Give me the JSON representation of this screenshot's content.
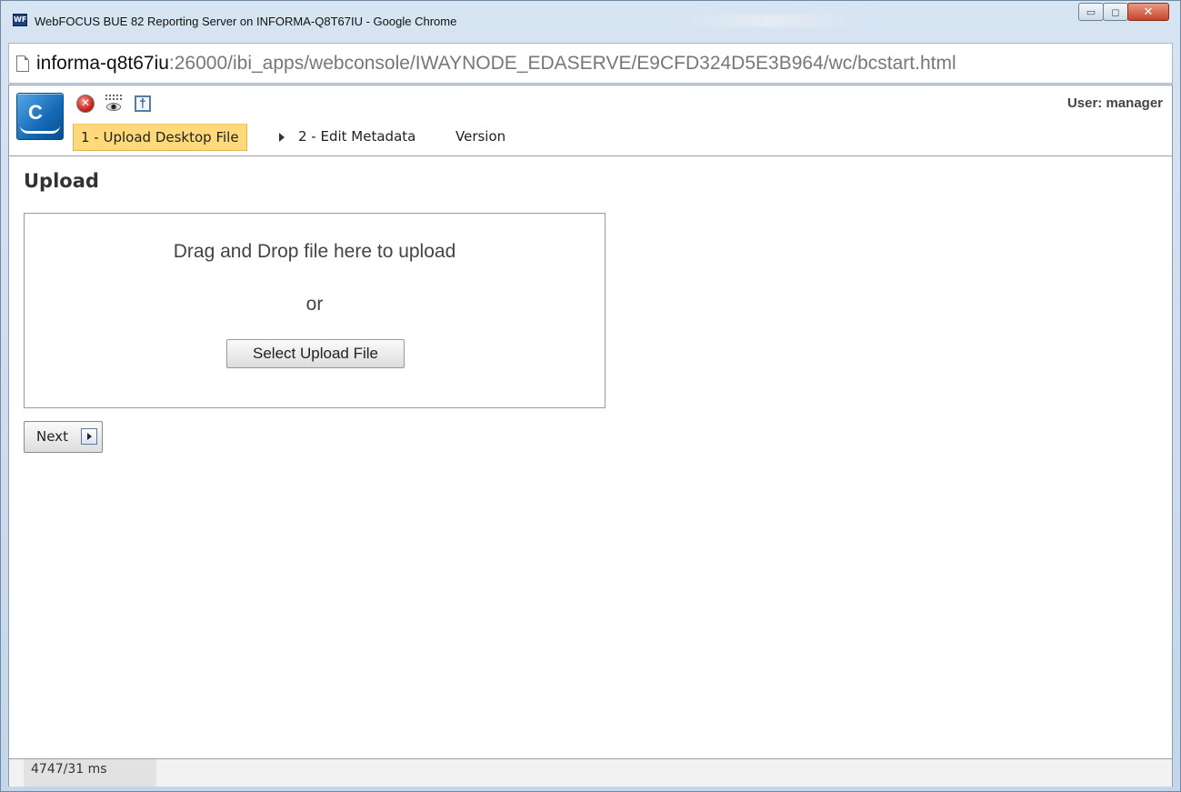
{
  "window": {
    "title": "WebFOCUS BUE 82 Reporting Server on INFORMA-Q8T67IU - Google Chrome",
    "app_icon_text": "WF"
  },
  "address_bar": {
    "host": "informa-q8t67iu",
    "path": ":26000/ibi_apps/webconsole/IWAYNODE_EDASERVE/E9CFD324D5E3B964/wc/bcstart.html"
  },
  "app_header": {
    "logo_letter": "C",
    "user_label": "User: manager",
    "tools": [
      "stop-icon",
      "view-icon",
      "help-icon"
    ]
  },
  "wizard_tabs": [
    {
      "label": "1 - Upload Desktop File",
      "active": true
    },
    {
      "label": "2 - Edit Metadata",
      "active": false
    },
    {
      "label": "Version",
      "active": false
    }
  ],
  "main": {
    "heading": "Upload",
    "dropzone_text": "Drag and Drop file here to upload",
    "dropzone_or": "or",
    "select_button": "Select Upload File",
    "next_button": "Next"
  },
  "status": {
    "timing": "4747/31 ms"
  }
}
